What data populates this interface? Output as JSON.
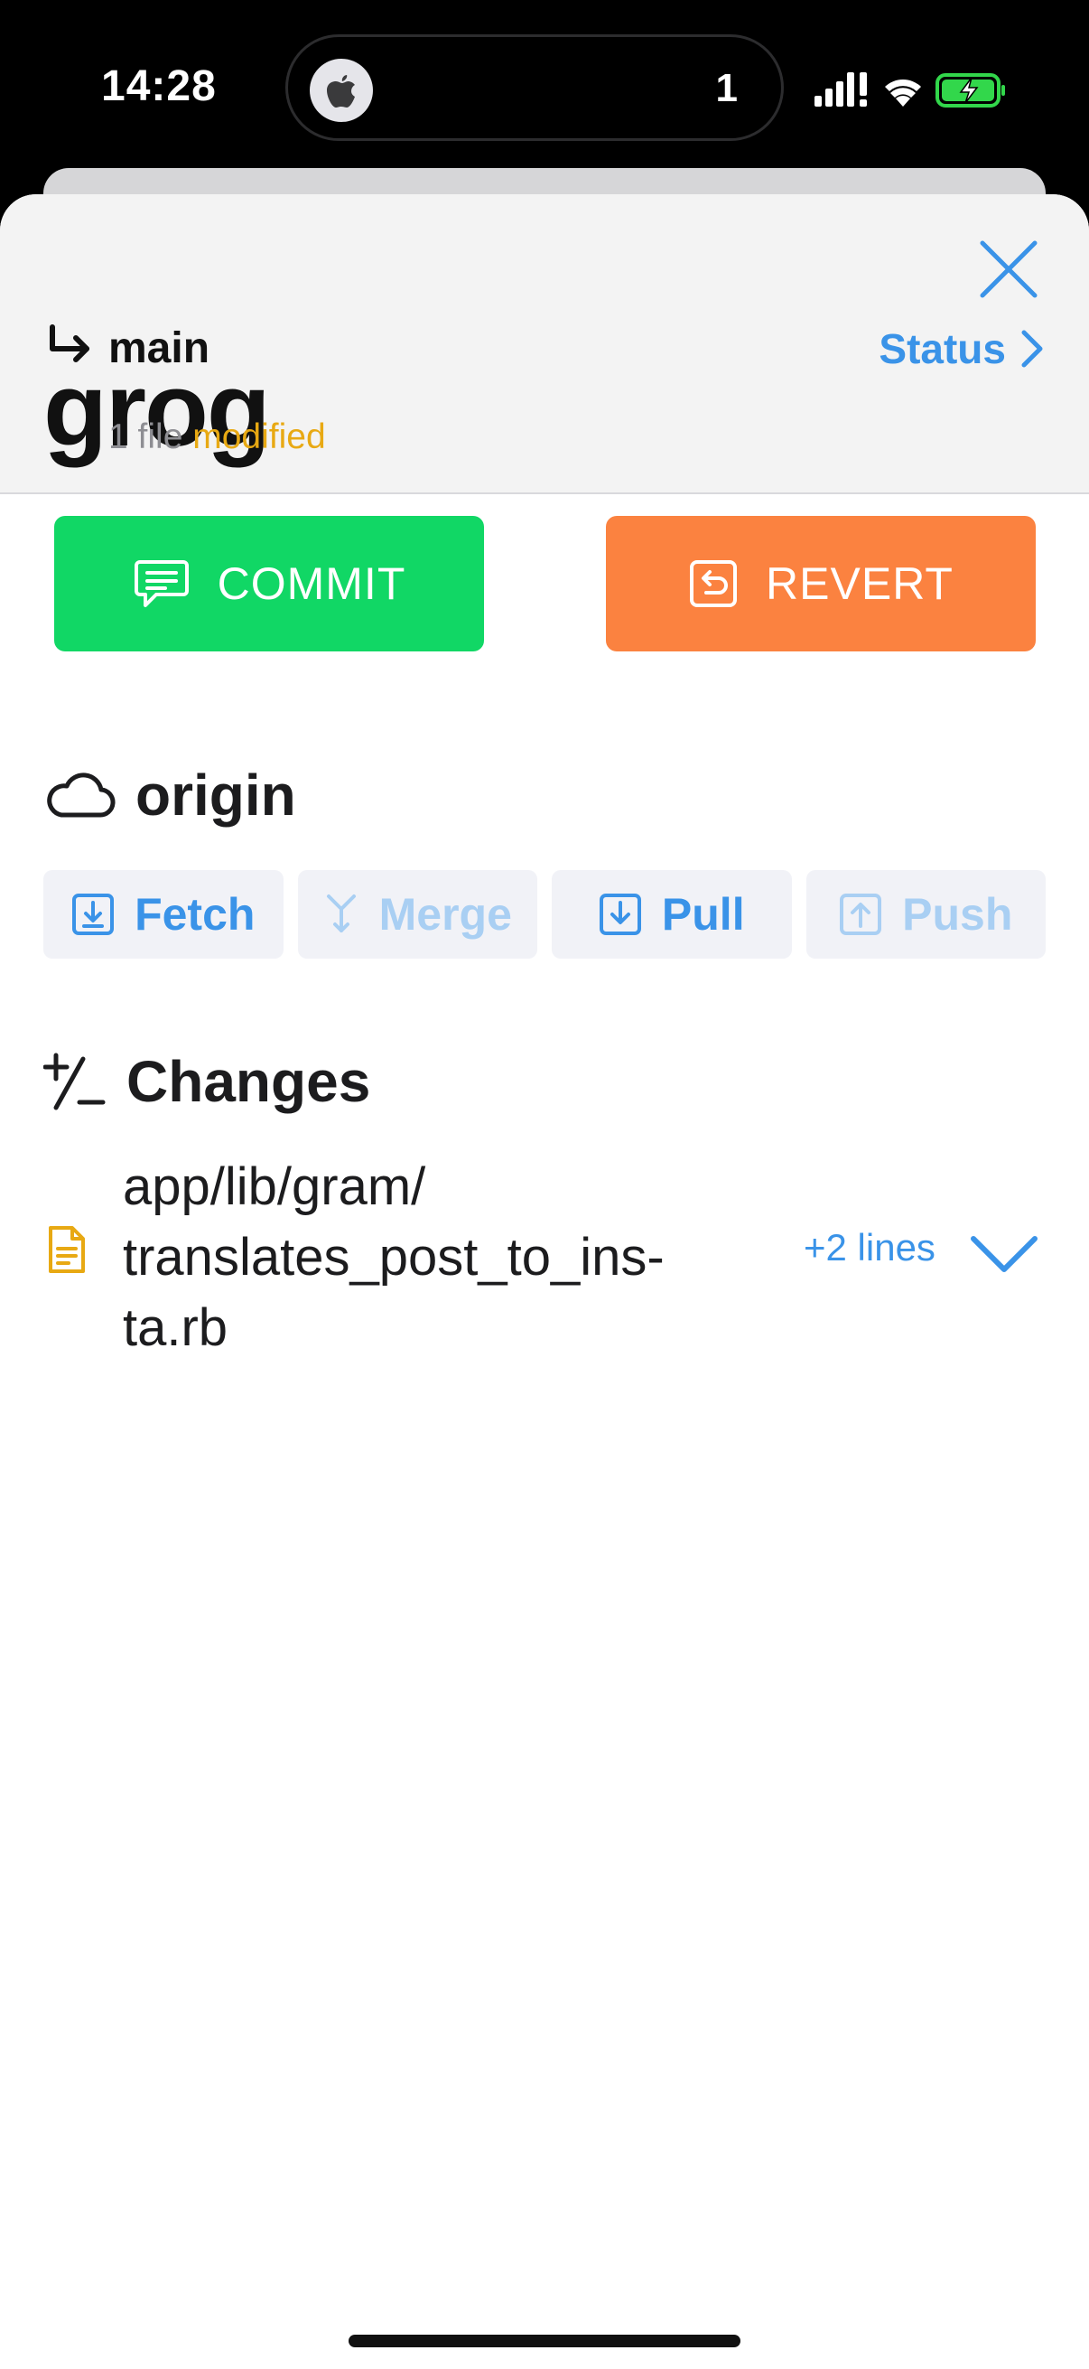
{
  "status_bar": {
    "time": "14:28",
    "island_count": "1"
  },
  "header": {
    "repo_name": "grog"
  },
  "branch": {
    "name": "main",
    "status_link": "Status"
  },
  "summary": {
    "prefix": "1 file ",
    "state": "modified"
  },
  "actions": {
    "commit_label": "COMMIT",
    "revert_label": "REVERT"
  },
  "origin": {
    "title": "origin",
    "buttons": [
      {
        "label": "Fetch",
        "enabled": true,
        "icon": "download-icon"
      },
      {
        "label": "Merge",
        "enabled": false,
        "icon": "merge-icon"
      },
      {
        "label": "Pull",
        "enabled": true,
        "icon": "download-icon"
      },
      {
        "label": "Push",
        "enabled": false,
        "icon": "upload-icon"
      }
    ]
  },
  "changes": {
    "title": "Changes",
    "files": [
      {
        "path_lines": [
          "app/lib/gram/",
          "translates_post_to_ins-",
          "ta.rb"
        ],
        "delta": "+2 lines",
        "icon": "file-document-icon"
      }
    ]
  },
  "colors": {
    "accent": "#3a93e8",
    "accent_disabled": "#a9cff3",
    "commit": "#11d765",
    "revert": "#fb8240",
    "modified": "#e8a913"
  }
}
